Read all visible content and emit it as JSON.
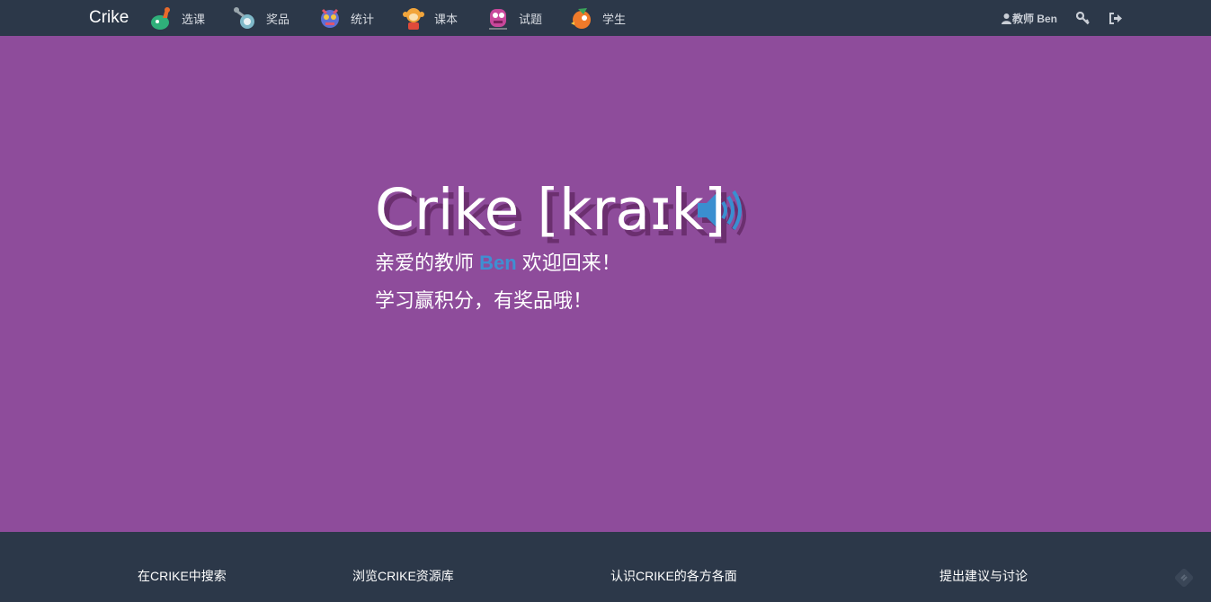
{
  "brand": "Crike",
  "nav": {
    "items": [
      {
        "label": "选课",
        "icon": "dino-mascot-icon"
      },
      {
        "label": "奖品",
        "icon": "robot-mascot-icon"
      },
      {
        "label": "统计",
        "icon": "monster-mascot-icon"
      },
      {
        "label": "课本",
        "icon": "monkey-mascot-icon"
      },
      {
        "label": "试题",
        "icon": "pink-monster-mascot-icon"
      },
      {
        "label": "学生",
        "icon": "bird-mascot-icon"
      }
    ],
    "user_label": "教师 Ben",
    "user_icon": "user-icon",
    "key_icon": "key-icon",
    "logout_icon": "sign-out-icon"
  },
  "hero": {
    "title": "Crike [kraɪk]",
    "welcome_prefix": "亲爱的教师 ",
    "welcome_name": "Ben",
    "welcome_suffix": " 欢迎回来！",
    "tagline": "学习赢积分，有奖品哦！",
    "speaker_icon": "speaker-volume-icon"
  },
  "footer": {
    "links": [
      "在CRIKE中搜索",
      "浏览CRIKE资源库",
      "认识CRIKE的各方各面",
      "提出建议与讨论"
    ],
    "corner_icon": "collapse-icon"
  },
  "colors": {
    "navbar": "#2c3849",
    "hero_background": "#8e4c9b",
    "accent_name": "#3f8fd2",
    "speaker": "#3a8fd0",
    "title_shadow": "#6b2f6f"
  }
}
